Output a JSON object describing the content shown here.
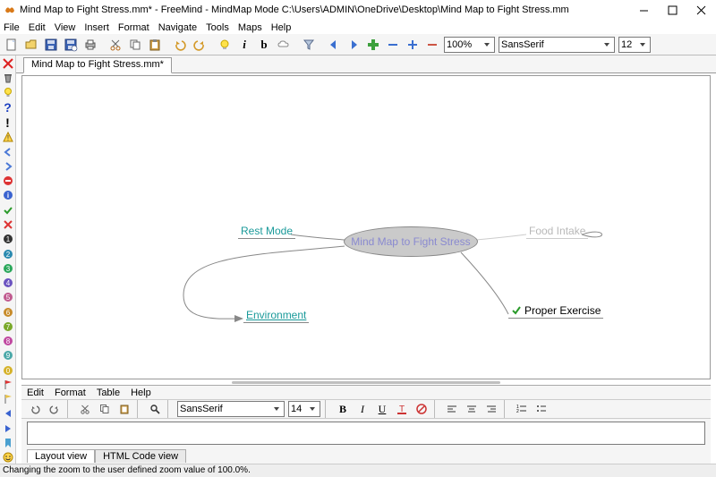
{
  "title": "Mind Map to Fight Stress.mm* - FreeMind - MindMap Mode C:\\Users\\ADMIN\\OneDrive\\Desktop\\Mind Map to Fight Stress.mm",
  "menubar": [
    "File",
    "Edit",
    "View",
    "Insert",
    "Format",
    "Navigate",
    "Tools",
    "Maps",
    "Help"
  ],
  "toolbar": {
    "zoom": "100%",
    "font": "SansSerif",
    "fontsize": "12"
  },
  "tabs": [
    "Mind Map to Fight Stress.mm*"
  ],
  "mindmap": {
    "center": "Mind Map to Fight Stress",
    "left_top": "Rest Mode",
    "left_bottom": "Environment",
    "right_top": "Food Intake",
    "right_bottom": "Proper Exercise"
  },
  "editor": {
    "menubar": [
      "Edit",
      "Format",
      "Table",
      "Help"
    ],
    "font": "SansSerif",
    "fontsize": "14",
    "tabs": [
      "Layout view",
      "HTML Code view"
    ]
  },
  "status": "Changing the zoom to the user defined zoom value of 100.0%."
}
